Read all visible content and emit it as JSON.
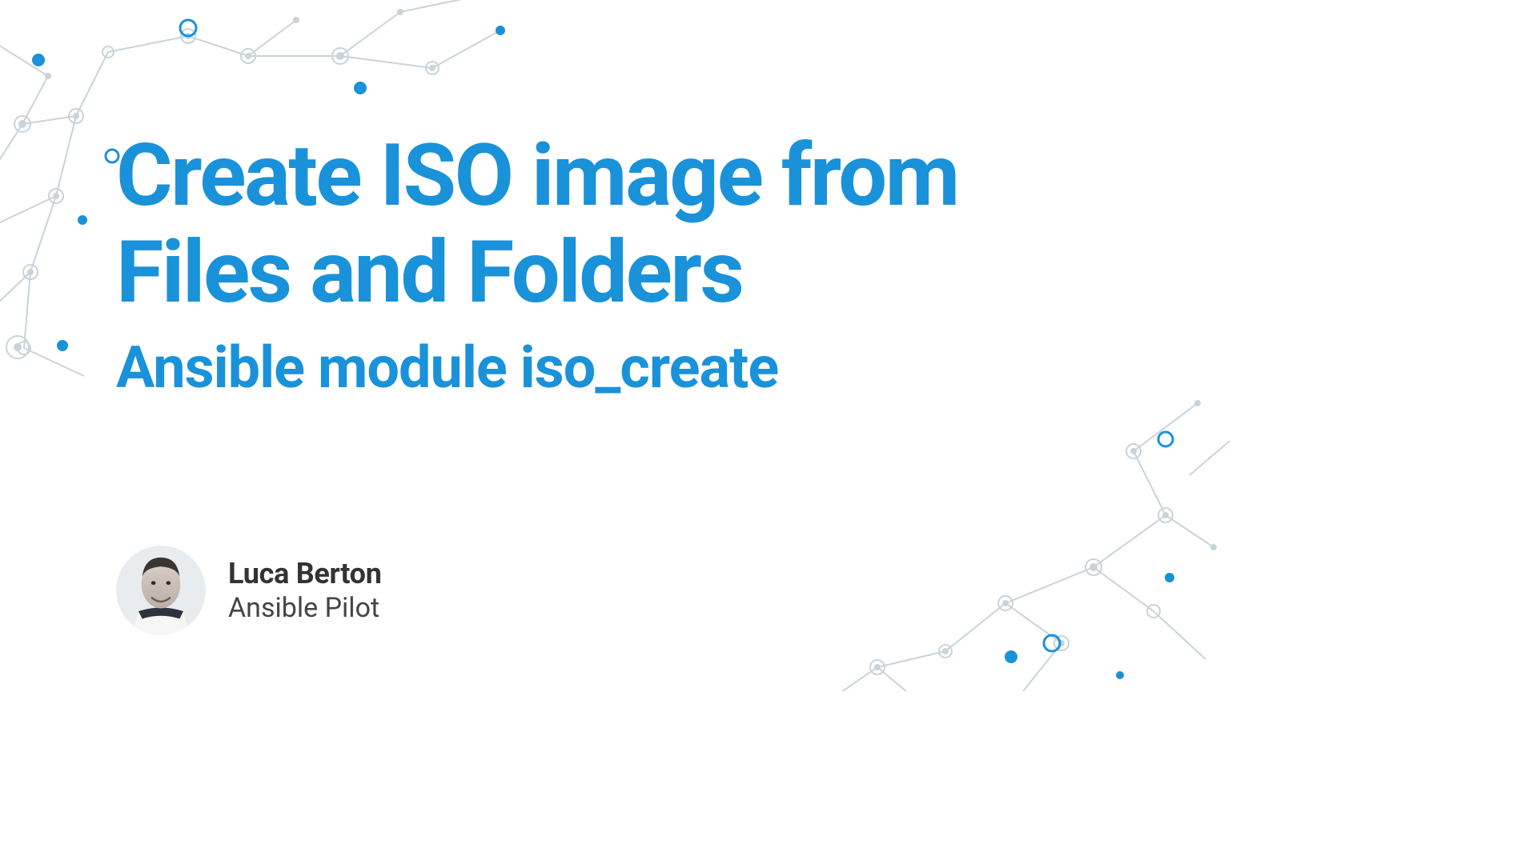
{
  "title": "Create ISO image from Files and Folders",
  "subtitle": "Ansible module iso_create",
  "author": {
    "name": "Luca Berton",
    "role": "Ansible Pilot"
  },
  "colors": {
    "accent": "#1a92d9",
    "text_dark": "#333333",
    "network_light": "#c9d3da",
    "network_blue": "#1a92d9"
  }
}
